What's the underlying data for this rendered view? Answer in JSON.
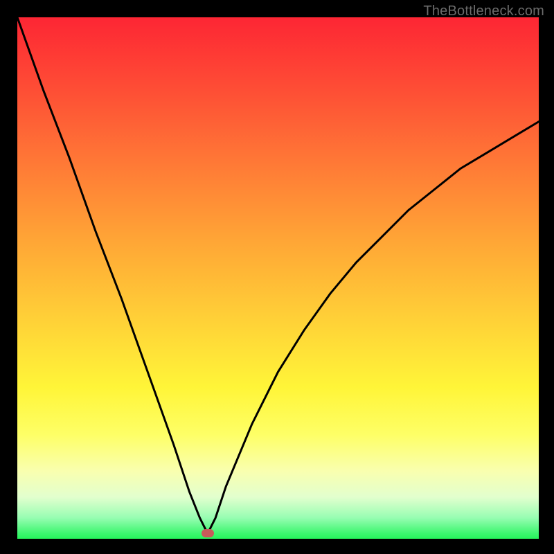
{
  "watermark": "TheBottleneck.com",
  "chart_data": {
    "type": "line",
    "title": "",
    "xlabel": "",
    "ylabel": "",
    "xlim": [
      0,
      100
    ],
    "ylim": [
      0,
      100
    ],
    "grid": false,
    "legend": false,
    "background_gradient": {
      "top": "#fd2634",
      "bottom": "#26f45b",
      "description": "vertical red-to-green gradient"
    },
    "series": [
      {
        "name": "bottleneck-curve",
        "color": "#000000",
        "x": [
          0,
          5,
          10,
          15,
          20,
          25,
          30,
          33,
          35,
          36.5,
          38,
          40,
          45,
          50,
          55,
          60,
          65,
          70,
          75,
          80,
          85,
          90,
          95,
          100
        ],
        "y": [
          100,
          86,
          73,
          59,
          46,
          32,
          18,
          9,
          4,
          1,
          4,
          10,
          22,
          32,
          40,
          47,
          53,
          58,
          63,
          67,
          71,
          74,
          77,
          80
        ]
      }
    ],
    "marker": {
      "x": 36.5,
      "y": 1,
      "color": "#c85a5a",
      "shape": "rounded-rect"
    }
  },
  "colors": {
    "frame": "#000000",
    "curve": "#000000",
    "watermark": "#6b6b6b",
    "marker": "#c85a5a"
  }
}
